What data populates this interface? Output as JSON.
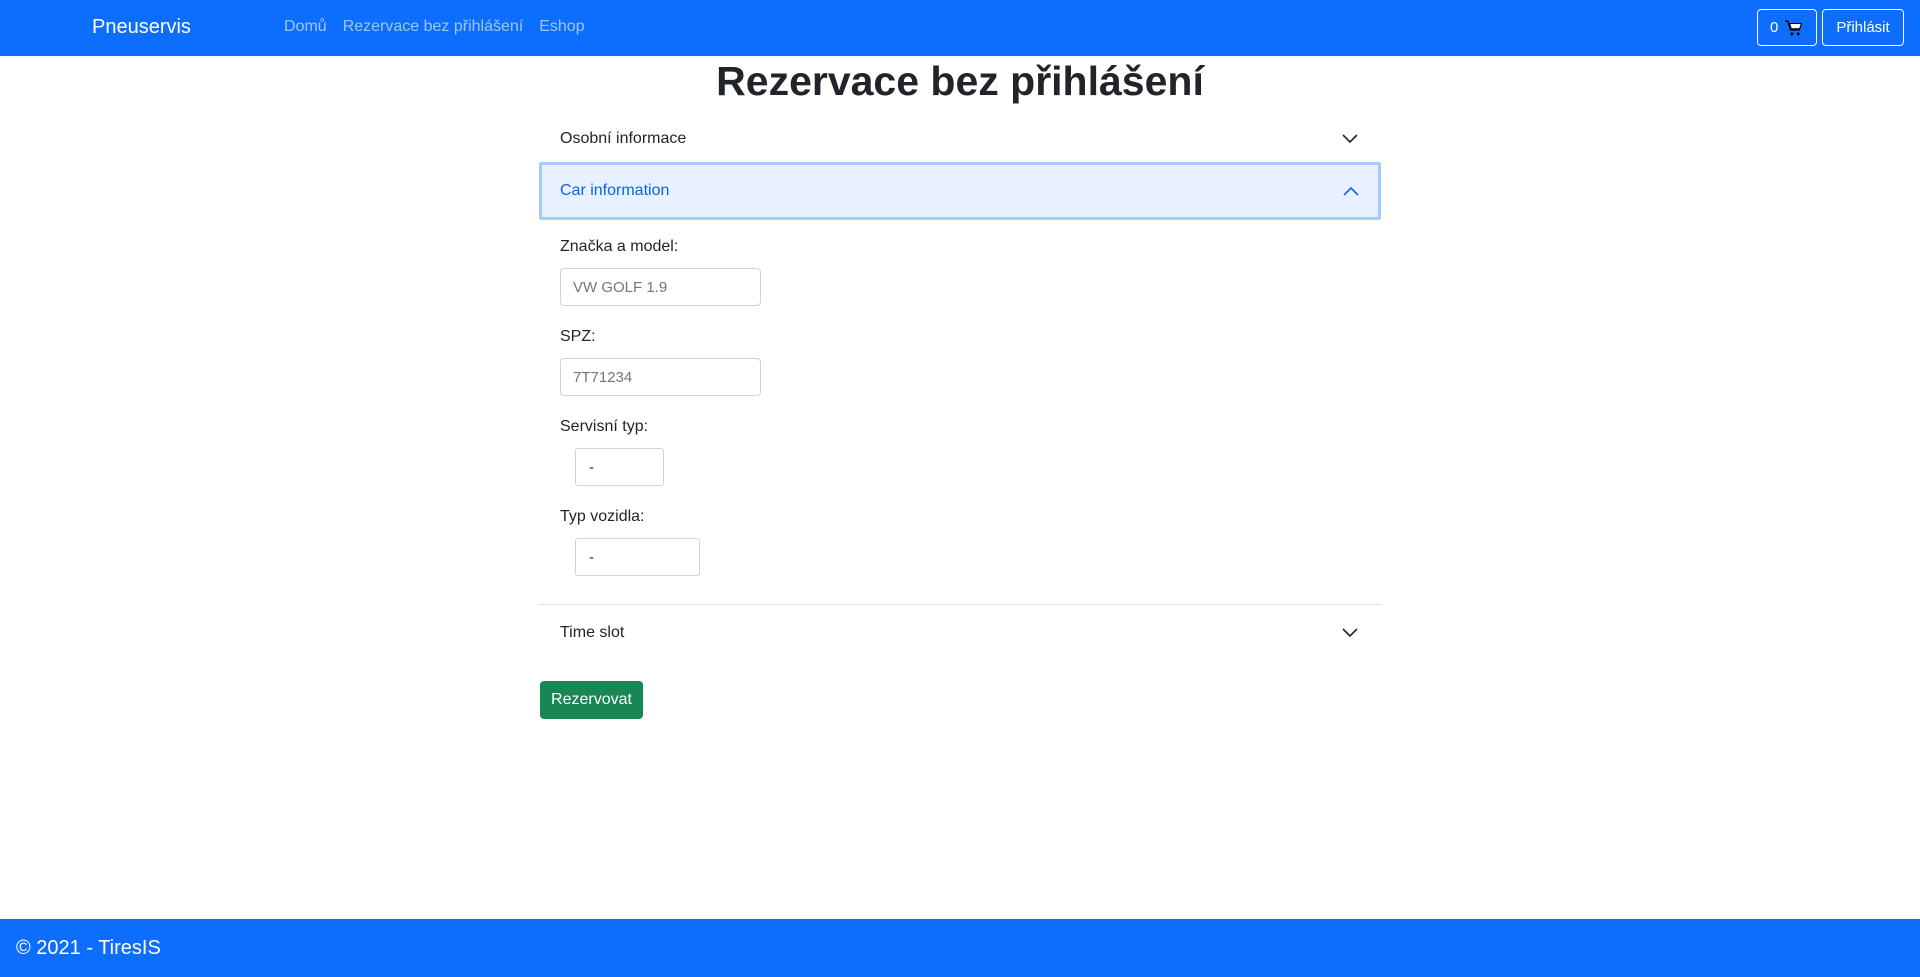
{
  "navbar": {
    "brand": "Pneuservis",
    "links": [
      "Domů",
      "Rezervace bez přihlášení",
      "Eshop"
    ],
    "cart_count": "0",
    "login_label": "Přihlásit"
  },
  "page": {
    "title": "Rezervace bez přihlášení"
  },
  "accordion": {
    "sections": [
      {
        "label": "Osobní informace",
        "expanded": false
      },
      {
        "label": "Car information",
        "expanded": true
      },
      {
        "label": "Time slot",
        "expanded": false
      }
    ]
  },
  "form": {
    "brand_model_label": "Značka a model:",
    "brand_model_placeholder": "VW GOLF 1.9",
    "plate_label": "SPZ:",
    "plate_placeholder": "7T71234",
    "service_type_label": "Servisní typ:",
    "service_type_value": "-",
    "vehicle_type_label": "Typ vozidla:",
    "vehicle_type_value": "-"
  },
  "submit_label": "Rezervovat",
  "footer": {
    "text": "© 2021 - TiresIS"
  },
  "colors": {
    "primary": "#0d6efd",
    "success": "#198754",
    "active_bg": "#e7f1ff",
    "active_text": "#0c63e4"
  },
  "icons": {
    "cart": "cart-icon",
    "chevron_down": "chevron-down-icon",
    "chevron_up": "chevron-up-icon"
  }
}
